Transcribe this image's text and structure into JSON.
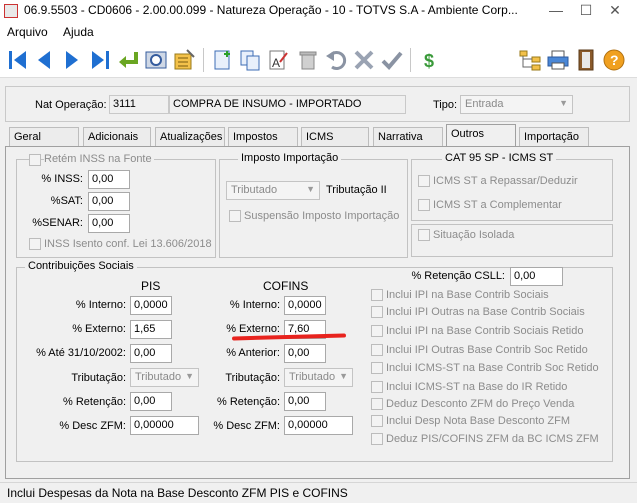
{
  "window": {
    "title": "06.9.5503 - CD0606 - 2.00.00.099 - Natureza Operação - 10 - TOTVS S.A - Ambiente Corp...",
    "minimize": "—",
    "maximize": "☐",
    "close": "✕"
  },
  "menu": {
    "items": [
      "Arquivo",
      "Ajuda"
    ]
  },
  "header": {
    "nat_label": "Nat Operação:",
    "nat_code": "3111",
    "nat_desc": "COMPRA DE INSUMO - IMPORTADO",
    "tipo_label": "Tipo:",
    "tipo_value": "Entrada"
  },
  "tabs": [
    "Geral",
    "Adicionais",
    "Atualizações",
    "Impostos",
    "ICMS",
    "Narrativa",
    "Outros",
    "Importação"
  ],
  "active_tab": "Outros",
  "inss": {
    "retem_label": "Retém INSS na Fonte",
    "pinss_label": "% INSS:",
    "pinss": "0,00",
    "psat_label": "%SAT:",
    "psat": "0,00",
    "psenar_label": "%SENAR:",
    "psenar": "0,00",
    "isento_label": "INSS Isento conf. Lei 13.606/2018"
  },
  "imposto_importacao": {
    "title": "Imposto Importação",
    "select_value": "Tributado",
    "tributacao_label": "Tributação II",
    "suspensao_label": "Suspensão Imposto Importação"
  },
  "cat95": {
    "title": "CAT 95 SP - ICMS ST",
    "repassar_label": "ICMS ST a Repassar/Deduzir",
    "complementar_label": "ICMS ST a Complementar"
  },
  "situacao_isolada_label": "Situação Isolada",
  "contrib": {
    "title": "Contribuições Sociais",
    "pis": {
      "heading": "PIS",
      "interno_label": "% Interno:",
      "interno": "0,0000",
      "externo_label": "% Externo:",
      "externo": "1,65",
      "ate_label": "% Até 31/10/2002:",
      "ate": "0,00",
      "trib_label": "Tributação:",
      "trib": "Tributado",
      "retencao_label": "% Retenção:",
      "retencao": "0,00",
      "zfm_label": "% Desc ZFM:",
      "zfm": "0,00000"
    },
    "cofins": {
      "heading": "COFINS",
      "interno_label": "% Interno:",
      "interno": "0,0000",
      "externo_label": "% Externo:",
      "externo": "7,60",
      "anterior_label": "% Anterior:",
      "anterior": "0,00",
      "trib_label": "Tributação:",
      "trib": "Tributado",
      "retencao_label": "% Retenção:",
      "retencao": "0,00",
      "zfm_label": "% Desc ZFM:",
      "zfm": "0,00000"
    },
    "csll_label": "% Retenção CSLL:",
    "csll": "0,00",
    "options": [
      "Inclui IPI na Base Contrib Sociais",
      "Inclui IPI Outras na Base Contrib Sociais",
      "Inclui IPI na Base Contrib Sociais Retido",
      "Inclui IPI Outras Base Contrib Soc Retido",
      "Inclui ICMS-ST na Base Contrib Soc Retido",
      "Inclui ICMS-ST na Base do IR Retido",
      "Deduz Desconto ZFM do Preço Venda",
      "Inclui Desp Nota Base Desconto ZFM",
      "Deduz PIS/COFINS ZFM da BC ICMS ZFM"
    ]
  },
  "status_text": "Inclui Despesas da Nota na Base Desconto ZFM PIS e COFINS",
  "colors": {
    "highlight": "#e8231e",
    "toolbar_blue": "#1f6fd1",
    "accent_green": "#3a9a3a"
  }
}
